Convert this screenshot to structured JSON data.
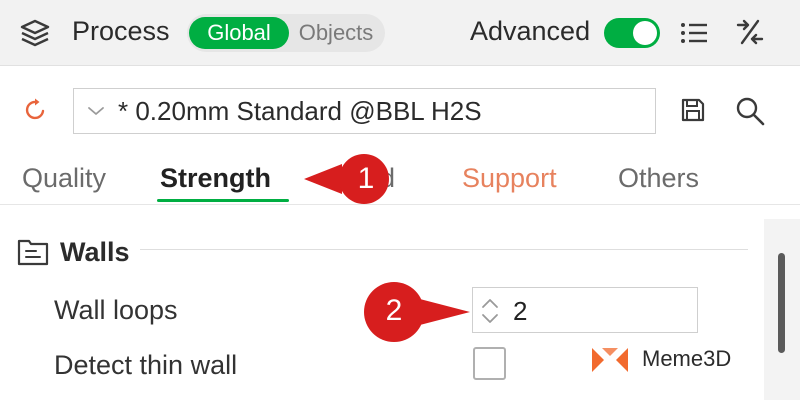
{
  "header": {
    "title": "Process",
    "scope_tabs": [
      "Global",
      "Objects"
    ],
    "advanced_label": "Advanced",
    "advanced_enabled": true
  },
  "preset": {
    "value": "* 0.20mm Standard @BBL H2S"
  },
  "tabs": [
    {
      "label": "Quality",
      "active": false
    },
    {
      "label": "Strength",
      "active": true
    },
    {
      "label": "d",
      "active": false
    },
    {
      "label": "Support",
      "active": false
    },
    {
      "label": "Others",
      "active": false
    }
  ],
  "callouts": [
    "1",
    "2"
  ],
  "section": {
    "title": "Walls",
    "rows": [
      {
        "label": "Wall loops",
        "value": "2"
      },
      {
        "label": "Detect thin wall",
        "checked": false
      }
    ]
  },
  "brand": {
    "name": "Meme3D"
  },
  "colors": {
    "accent": "#00ae42",
    "support_tab": "#e7825e",
    "callout": "#d71e1e",
    "reset_icon": "#e8643c",
    "brand_mark": "#f26a2e"
  },
  "icons": [
    "layers-icon",
    "list-icon",
    "compare-icon",
    "reset-icon",
    "chevron-down-icon",
    "save-icon",
    "search-icon",
    "walls-icon",
    "spin-arrows-icon"
  ]
}
